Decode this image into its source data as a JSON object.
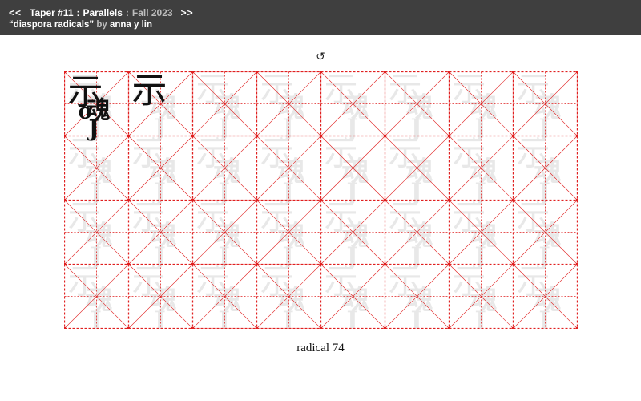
{
  "header": {
    "prev_label": "<<",
    "series_name": "Taper #11",
    "separator1": ":",
    "issue_name": "Parallels",
    "separator2": ":",
    "season": "Fall 2023",
    "next_label": ">>",
    "work_title": "“diaspora radicals”",
    "by_word": "by",
    "author": "anna y lin"
  },
  "reload_icon": "↺",
  "grid": {
    "rows": 4,
    "cols": 8,
    "ghost_glyph": "魂",
    "ghost_radical": "示",
    "ghost_mark": "J",
    "active_cells": [
      {
        "radical": "示",
        "fragment": "魂",
        "extra": "o",
        "mark": "J"
      },
      {
        "radical": "示"
      }
    ],
    "colors": {
      "line": "#e02020",
      "ghost": "#e8e8e8",
      "ink": "#111111"
    }
  },
  "caption": "radical 74"
}
